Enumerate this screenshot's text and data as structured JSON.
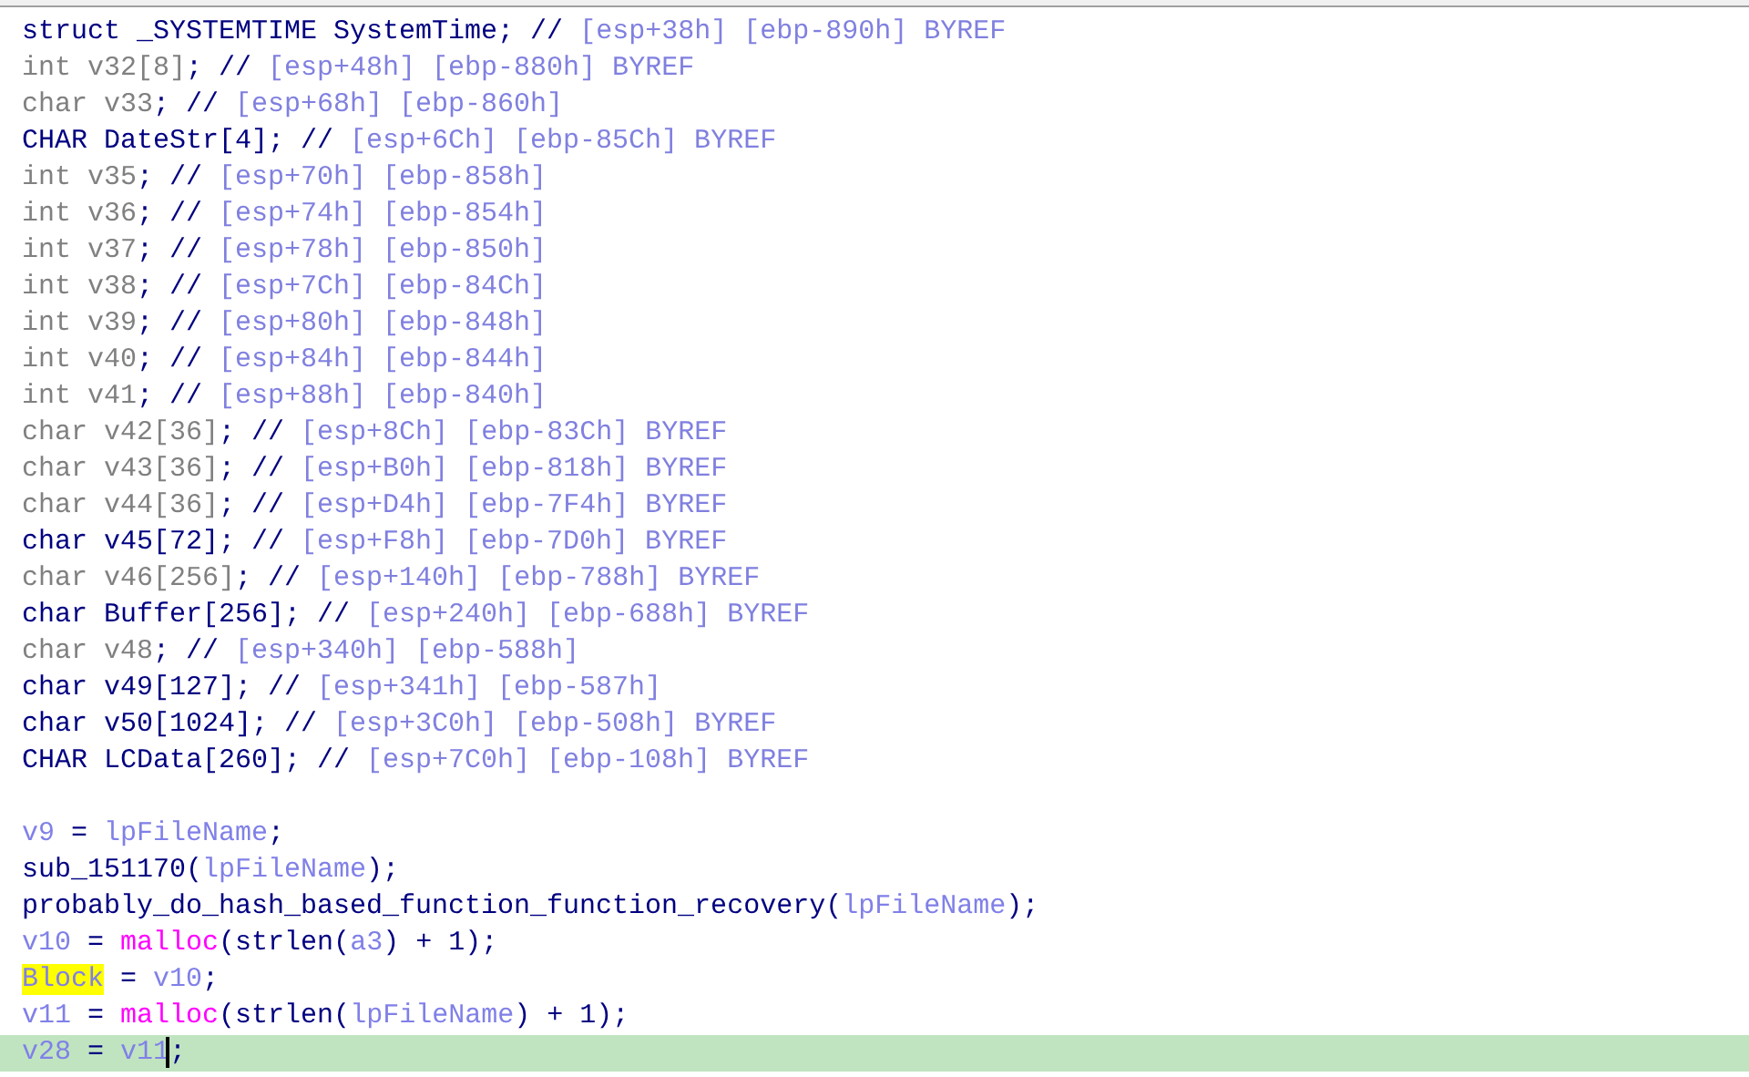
{
  "declarations": [
    {
      "selected": false,
      "tokens": [
        {
          "kind": "code",
          "text": "struct _SYSTEMTIME SystemTime; // "
        },
        {
          "kind": "comment",
          "text": "[esp+38h] [ebp-890h] BYREF"
        }
      ]
    },
    {
      "selected": false,
      "tokens": [
        {
          "kind": "unused",
          "text": "int v32[8]"
        },
        {
          "kind": "code",
          "text": "; // "
        },
        {
          "kind": "comment",
          "text": "[esp+48h] [ebp-880h] BYREF"
        }
      ]
    },
    {
      "selected": false,
      "tokens": [
        {
          "kind": "unused",
          "text": "char v33"
        },
        {
          "kind": "code",
          "text": "; // "
        },
        {
          "kind": "comment",
          "text": "[esp+68h] [ebp-860h]"
        }
      ]
    },
    {
      "selected": false,
      "tokens": [
        {
          "kind": "code",
          "text": "CHAR DateStr[4]; // "
        },
        {
          "kind": "comment",
          "text": "[esp+6Ch] [ebp-85Ch] BYREF"
        }
      ]
    },
    {
      "selected": false,
      "tokens": [
        {
          "kind": "unused",
          "text": "int v35"
        },
        {
          "kind": "code",
          "text": "; // "
        },
        {
          "kind": "comment",
          "text": "[esp+70h] [ebp-858h]"
        }
      ]
    },
    {
      "selected": false,
      "tokens": [
        {
          "kind": "unused",
          "text": "int v36"
        },
        {
          "kind": "code",
          "text": "; // "
        },
        {
          "kind": "comment",
          "text": "[esp+74h] [ebp-854h]"
        }
      ]
    },
    {
      "selected": false,
      "tokens": [
        {
          "kind": "unused",
          "text": "int v37"
        },
        {
          "kind": "code",
          "text": "; // "
        },
        {
          "kind": "comment",
          "text": "[esp+78h] [ebp-850h]"
        }
      ]
    },
    {
      "selected": false,
      "tokens": [
        {
          "kind": "unused",
          "text": "int v38"
        },
        {
          "kind": "code",
          "text": "; // "
        },
        {
          "kind": "comment",
          "text": "[esp+7Ch] [ebp-84Ch]"
        }
      ]
    },
    {
      "selected": false,
      "tokens": [
        {
          "kind": "unused",
          "text": "int v39"
        },
        {
          "kind": "code",
          "text": "; // "
        },
        {
          "kind": "comment",
          "text": "[esp+80h] [ebp-848h]"
        }
      ]
    },
    {
      "selected": false,
      "tokens": [
        {
          "kind": "unused",
          "text": "int v40"
        },
        {
          "kind": "code",
          "text": "; // "
        },
        {
          "kind": "comment",
          "text": "[esp+84h] [ebp-844h]"
        }
      ]
    },
    {
      "selected": false,
      "tokens": [
        {
          "kind": "unused",
          "text": "int v41"
        },
        {
          "kind": "code",
          "text": "; // "
        },
        {
          "kind": "comment",
          "text": "[esp+88h] [ebp-840h]"
        }
      ]
    },
    {
      "selected": false,
      "tokens": [
        {
          "kind": "unused",
          "text": "char v42[36]"
        },
        {
          "kind": "code",
          "text": "; // "
        },
        {
          "kind": "comment",
          "text": "[esp+8Ch] [ebp-83Ch] BYREF"
        }
      ]
    },
    {
      "selected": false,
      "tokens": [
        {
          "kind": "unused",
          "text": "char v43[36]"
        },
        {
          "kind": "code",
          "text": "; // "
        },
        {
          "kind": "comment",
          "text": "[esp+B0h] [ebp-818h] BYREF"
        }
      ]
    },
    {
      "selected": false,
      "tokens": [
        {
          "kind": "unused",
          "text": "char v44[36]"
        },
        {
          "kind": "code",
          "text": "; // "
        },
        {
          "kind": "comment",
          "text": "[esp+D4h] [ebp-7F4h] BYREF"
        }
      ]
    },
    {
      "selected": false,
      "tokens": [
        {
          "kind": "code",
          "text": "char v45[72]; // "
        },
        {
          "kind": "comment",
          "text": "[esp+F8h] [ebp-7D0h] BYREF"
        }
      ]
    },
    {
      "selected": false,
      "tokens": [
        {
          "kind": "unused",
          "text": "char v46[256]"
        },
        {
          "kind": "code",
          "text": "; // "
        },
        {
          "kind": "comment",
          "text": "[esp+140h] [ebp-788h] BYREF"
        }
      ]
    },
    {
      "selected": false,
      "tokens": [
        {
          "kind": "code",
          "text": "char Buffer[256]; // "
        },
        {
          "kind": "comment",
          "text": "[esp+240h] [ebp-688h] BYREF"
        }
      ]
    },
    {
      "selected": false,
      "tokens": [
        {
          "kind": "unused",
          "text": "char v48"
        },
        {
          "kind": "code",
          "text": "; // "
        },
        {
          "kind": "comment",
          "text": "[esp+340h] [ebp-588h]"
        }
      ]
    },
    {
      "selected": false,
      "tokens": [
        {
          "kind": "code",
          "text": "char v49[127]; // "
        },
        {
          "kind": "comment",
          "text": "[esp+341h] [ebp-587h]"
        }
      ]
    },
    {
      "selected": false,
      "tokens": [
        {
          "kind": "code",
          "text": "char v50[1024]; // "
        },
        {
          "kind": "comment",
          "text": "[esp+3C0h] [ebp-508h] BYREF"
        }
      ]
    },
    {
      "selected": false,
      "tokens": [
        {
          "kind": "code",
          "text": "CHAR LCData[260]; // "
        },
        {
          "kind": "comment",
          "text": "[esp+7C0h] [ebp-108h] BYREF"
        }
      ]
    }
  ],
  "statements": [
    {
      "selected": false,
      "tokens": [
        {
          "kind": "var",
          "text": "v9"
        },
        {
          "kind": "code",
          "text": " = "
        },
        {
          "kind": "var",
          "text": "lpFileName"
        },
        {
          "kind": "code",
          "text": ";"
        }
      ]
    },
    {
      "selected": false,
      "tokens": [
        {
          "kind": "code",
          "text": "sub_151170("
        },
        {
          "kind": "var",
          "text": "lpFileName"
        },
        {
          "kind": "code",
          "text": ");"
        }
      ]
    },
    {
      "selected": false,
      "tokens": [
        {
          "kind": "code",
          "text": "probably_do_hash_based_function_function_recovery("
        },
        {
          "kind": "var",
          "text": "lpFileName"
        },
        {
          "kind": "code",
          "text": ");"
        }
      ]
    },
    {
      "selected": false,
      "tokens": [
        {
          "kind": "var",
          "text": "v10"
        },
        {
          "kind": "code",
          "text": " = "
        },
        {
          "kind": "lib",
          "text": "malloc"
        },
        {
          "kind": "code",
          "text": "(strlen("
        },
        {
          "kind": "var",
          "text": "a3"
        },
        {
          "kind": "code",
          "text": ") + 1);"
        }
      ]
    },
    {
      "selected": false,
      "tokens": [
        {
          "kind": "highlight",
          "text": "Block"
        },
        {
          "kind": "code",
          "text": " = "
        },
        {
          "kind": "var",
          "text": "v10"
        },
        {
          "kind": "code",
          "text": ";"
        }
      ]
    },
    {
      "selected": false,
      "tokens": [
        {
          "kind": "var",
          "text": "v11"
        },
        {
          "kind": "code",
          "text": " = "
        },
        {
          "kind": "lib",
          "text": "malloc"
        },
        {
          "kind": "code",
          "text": "(strlen("
        },
        {
          "kind": "var",
          "text": "lpFileName"
        },
        {
          "kind": "code",
          "text": ") + 1);"
        }
      ]
    },
    {
      "selected": true,
      "tokens": [
        {
          "kind": "var",
          "text": "v28"
        },
        {
          "kind": "code",
          "text": " = "
        },
        {
          "kind": "var",
          "text": "v11"
        },
        {
          "kind": "code",
          "text": ";",
          "caret": true
        }
      ]
    }
  ]
}
